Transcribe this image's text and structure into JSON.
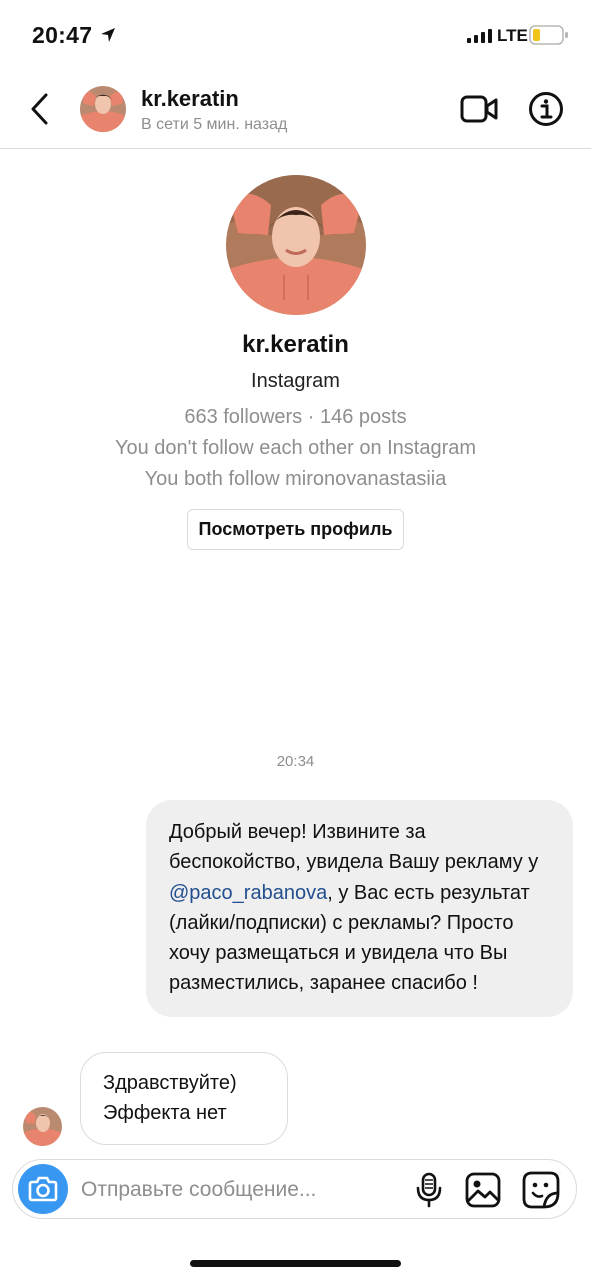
{
  "status_bar": {
    "time": "20:47",
    "network": "LTE"
  },
  "header": {
    "username": "kr.keratin",
    "activity_status": "В сети 5 мин. назад"
  },
  "profile": {
    "username": "kr.keratin",
    "platform": "Instagram",
    "stats": "663 followers · 146 posts",
    "follow_status": "You don't follow each other on Instagram",
    "mutual": "You both follow mironovanastasiia",
    "view_profile_label": "Посмотреть профиль"
  },
  "conversation": {
    "timestamp": "20:34",
    "outgoing_message": {
      "before_mention": "Добрый вечер! Извините за беспокойство, увидела Вашу рекламу у ",
      "mention": "@paco_rabanova",
      "after_mention": ", у Вас есть результат (лайки/подписки) с рекламы? Просто хочу размещаться и увидела что Вы разместились, заранее спасибо !"
    },
    "incoming_message": {
      "line1": "Здравствуйте)",
      "line2": "Эффекта нет"
    }
  },
  "composer": {
    "placeholder": "Отправьте сообщение..."
  },
  "colors": {
    "accent": "#3897f0",
    "mention": "#224f8f",
    "secondary_text": "#8e8e8e",
    "bubble_bg": "#efefef",
    "border": "#dbdbdb"
  },
  "icons": {
    "back": "chevron-left-icon",
    "video": "video-camera-icon",
    "info": "info-icon",
    "camera": "camera-icon",
    "mic": "microphone-icon",
    "gallery": "gallery-icon",
    "sticker": "sticker-icon"
  }
}
